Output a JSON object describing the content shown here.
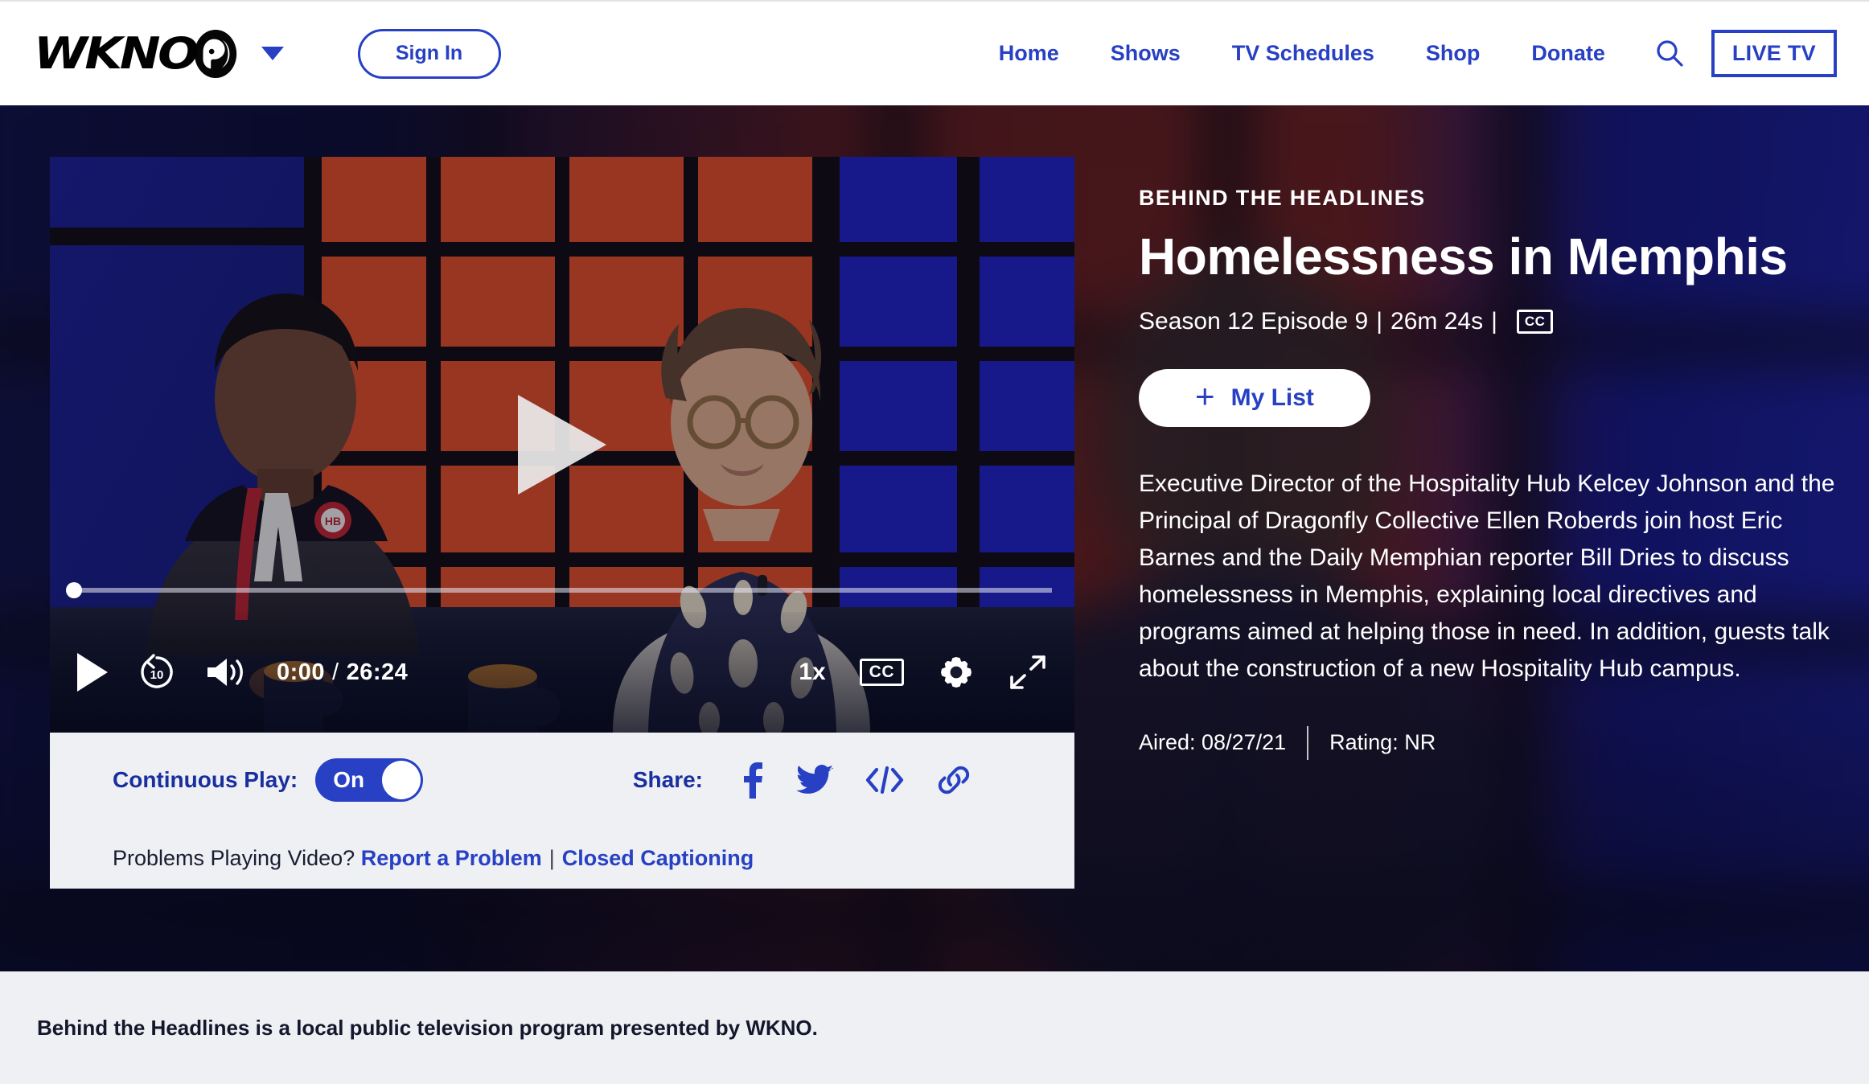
{
  "header": {
    "brand": {
      "wordmark": "WKNO",
      "pbs_icon": "pbs-logo-icon",
      "caret_icon": "chevron-down-icon"
    },
    "sign_in_label": "Sign In",
    "nav": [
      {
        "label": "Home"
      },
      {
        "label": "Shows"
      },
      {
        "label": "TV Schedules"
      },
      {
        "label": "Shop"
      },
      {
        "label": "Donate"
      }
    ],
    "search_icon": "search-icon",
    "live_tv_label": "LIVE TV"
  },
  "player": {
    "play_overlay_icon": "play-icon",
    "controls": {
      "play_icon": "play-icon",
      "rewind_label": "10",
      "rewind_icon": "replay-10-icon",
      "volume_icon": "volume-icon",
      "current_time": "0:00",
      "time_separator": "/",
      "duration": "26:24",
      "speed_label": "1x",
      "cc_label": "CC",
      "settings_icon": "gear-icon",
      "fullscreen_icon": "fullscreen-icon"
    },
    "progress_percent": 0
  },
  "options": {
    "continuous_play_label": "Continuous Play:",
    "continuous_play_state": "On",
    "share_label": "Share:",
    "share_icons": [
      {
        "name": "facebook-icon"
      },
      {
        "name": "twitter-icon"
      },
      {
        "name": "embed-code-icon"
      },
      {
        "name": "copy-link-icon"
      }
    ],
    "problems_prefix": "Problems Playing Video?",
    "report_link": "Report a Problem",
    "link_separator": "|",
    "captioning_link": "Closed Captioning"
  },
  "info": {
    "show_name": "BEHIND THE HEADLINES",
    "episode_title": "Homelessness in Memphis",
    "season_episode": "Season 12 Episode 9",
    "pipe1": "|",
    "duration": "26m 24s",
    "pipe2": "|",
    "cc_badge": "CC",
    "my_list_plus": "+",
    "my_list_label": "My List",
    "description": "Executive Director of the Hospitality Hub Kelcey Johnson and the Principal of Dragonfly Collective Ellen Roberds join host Eric Barnes and the Daily Memphian reporter Bill Dries to discuss homelessness in Memphis, explaining local directives and programs aimed at helping those in need. In addition, guests talk about the construction of a new Hospitality Hub campus.",
    "aired": "Aired: 08/27/21",
    "rating": "Rating: NR"
  },
  "footer": {
    "text": "Behind the Headlines is a local public television program presented by WKNO."
  },
  "colors": {
    "brand_blue": "#2740c4",
    "hero_navy": "#101255",
    "panel_gray": "#eef0f4",
    "text_dark": "#14162b"
  }
}
